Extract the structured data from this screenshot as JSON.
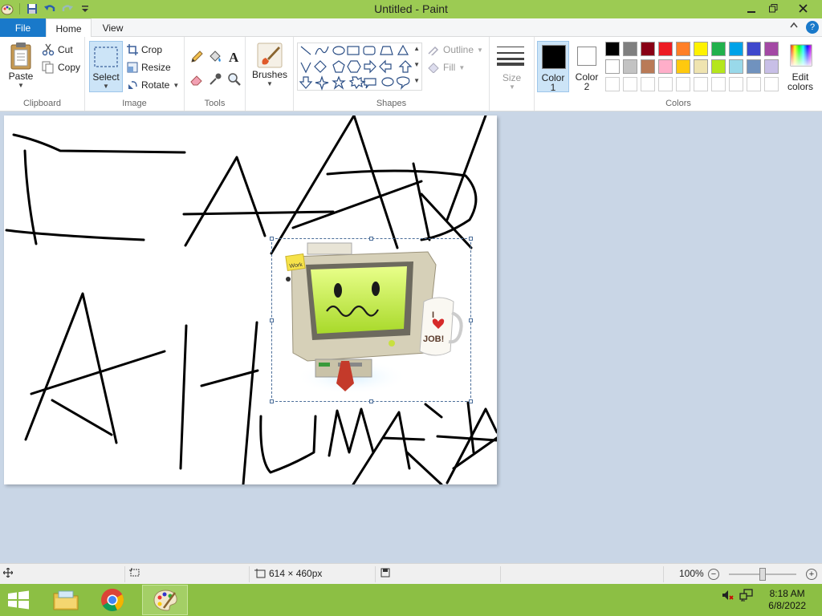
{
  "window": {
    "title": "Untitled - Paint"
  },
  "tabs": {
    "file": "File",
    "home": "Home",
    "view": "View"
  },
  "clipboard": {
    "paste": "Paste",
    "cut": "Cut",
    "copy": "Copy",
    "label": "Clipboard"
  },
  "image": {
    "select": "Select",
    "crop": "Crop",
    "resize": "Resize",
    "rotate": "Rotate",
    "label": "Image"
  },
  "tools": {
    "label": "Tools"
  },
  "brushes": {
    "label": "Brushes"
  },
  "shapes": {
    "outline": "Outline",
    "fill": "Fill",
    "label": "Shapes"
  },
  "size": {
    "label": "Size"
  },
  "colors": {
    "color1_label": "Color",
    "color1_num": "1",
    "color2_label": "Color",
    "color2_num": "2",
    "edit_label": "Edit",
    "edit_label2": "colors",
    "label": "Colors",
    "color1": "#000000",
    "color2": "#ffffff",
    "palette_row1": [
      "#000000",
      "#7f7f7f",
      "#880015",
      "#ed1c24",
      "#ff7f27",
      "#fff200",
      "#22b14c",
      "#00a2e8",
      "#3f48cc",
      "#a349a4"
    ],
    "palette_row2": [
      "#ffffff",
      "#c3c3c3",
      "#b97a57",
      "#ffaec9",
      "#ffc90e",
      "#efe4b0",
      "#b5e61d",
      "#99d9ea",
      "#7092be",
      "#c8bfe7"
    ]
  },
  "canvas": {
    "sticky_note": "Work",
    "mug_text_top": "I",
    "mug_text_bottom": "JOB!"
  },
  "status": {
    "dimensions": "614 × 460px",
    "zoom": "100%"
  },
  "taskbar": {
    "time": "8:18 AM",
    "date": "6/8/2022"
  }
}
